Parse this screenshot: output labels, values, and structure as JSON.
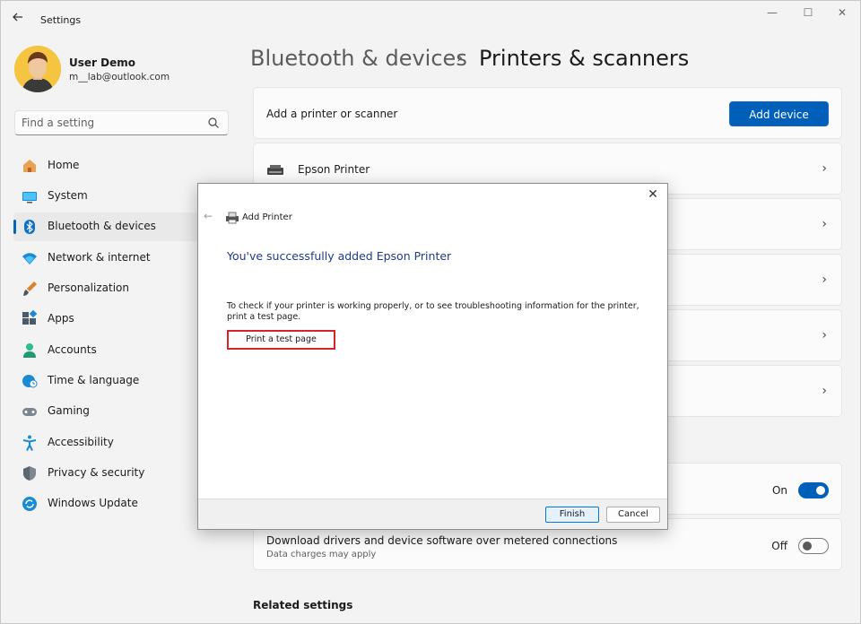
{
  "window": {
    "title": "Settings",
    "controls": {
      "minimize": "—",
      "maximize": "☐",
      "close": "✕"
    }
  },
  "profile": {
    "name": "User Demo",
    "email": "m__lab@outlook.com"
  },
  "search": {
    "placeholder": "Find a setting"
  },
  "sidebar": {
    "items": [
      {
        "label": "Home",
        "icon": "home-icon"
      },
      {
        "label": "System",
        "icon": "monitor-icon"
      },
      {
        "label": "Bluetooth & devices",
        "icon": "bluetooth-icon",
        "active": true
      },
      {
        "label": "Network & internet",
        "icon": "wifi-icon"
      },
      {
        "label": "Personalization",
        "icon": "brush-icon"
      },
      {
        "label": "Apps",
        "icon": "apps-icon"
      },
      {
        "label": "Accounts",
        "icon": "person-icon"
      },
      {
        "label": "Time & language",
        "icon": "globe-clock-icon"
      },
      {
        "label": "Gaming",
        "icon": "gamepad-icon"
      },
      {
        "label": "Accessibility",
        "icon": "accessibility-icon"
      },
      {
        "label": "Privacy & security",
        "icon": "shield-icon"
      },
      {
        "label": "Windows Update",
        "icon": "update-icon"
      }
    ]
  },
  "header": {
    "parent": "Bluetooth & devices",
    "separator": "›",
    "current": "Printers & scanners"
  },
  "main": {
    "add_row": {
      "label": "Add a printer or scanner",
      "button": "Add device"
    },
    "printers": [
      {
        "name": "Epson Printer"
      }
    ],
    "toggle_on_label": "On",
    "metered": {
      "label": "Download drivers and device software over metered connections",
      "sub": "Data charges may apply",
      "toggle_label": "Off"
    },
    "related": "Related settings"
  },
  "dialog": {
    "title": "Add Printer",
    "heading": "You've successfully added Epson Printer",
    "body": "To check if your printer is working properly, or to see troubleshooting information for the printer, print a test page.",
    "test_button": "Print a test page",
    "finish": "Finish",
    "cancel": "Cancel",
    "close": "✕",
    "back": "←"
  },
  "colors": {
    "accent": "#005fb8",
    "highlight_border": "#d8232a",
    "dialog_heading": "#1d3b8a"
  }
}
